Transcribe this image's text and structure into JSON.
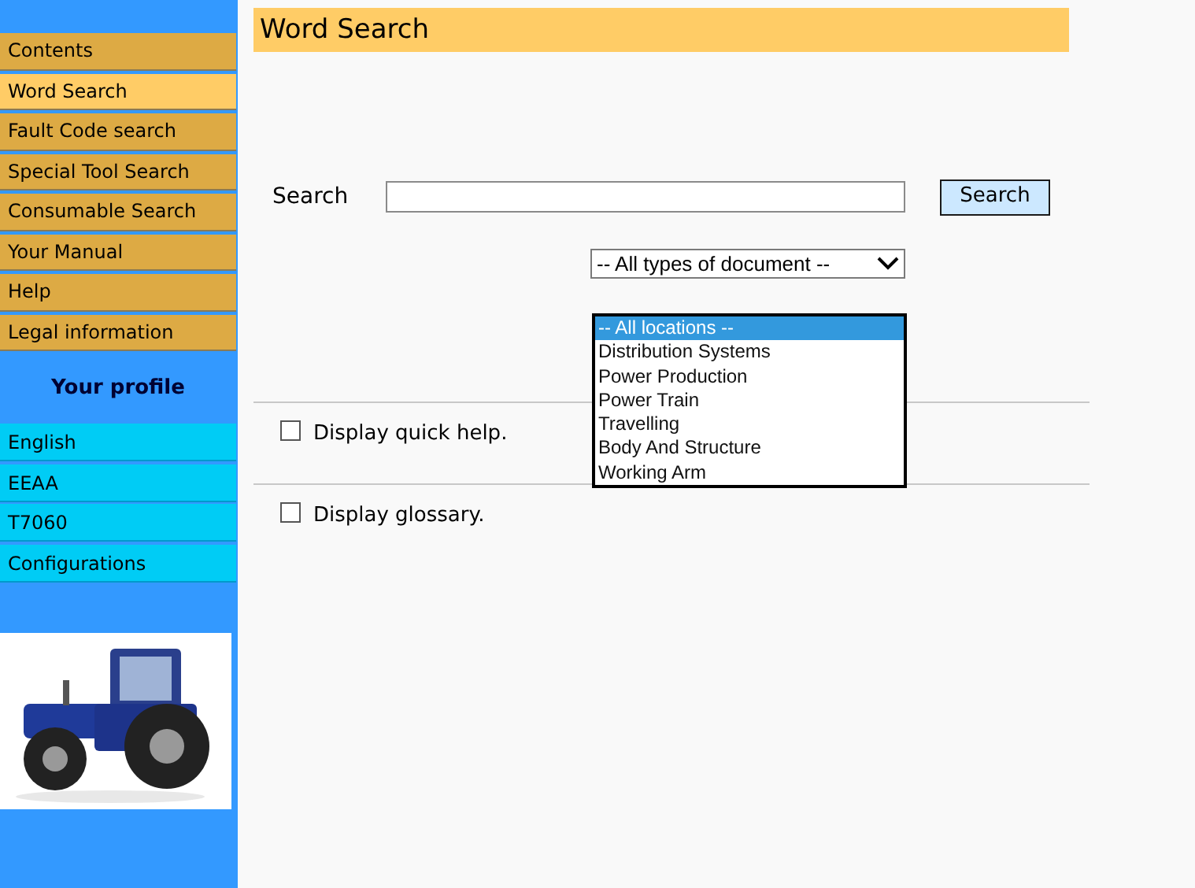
{
  "menu": [
    {
      "label": "Contents",
      "selected": false
    },
    {
      "label": "Word Search",
      "selected": true
    },
    {
      "label": "Fault Code search",
      "selected": false
    },
    {
      "label": "Special Tool Search",
      "selected": false
    },
    {
      "label": "Consumable Search",
      "selected": false
    },
    {
      "label": "Your Manual",
      "selected": false
    },
    {
      "label": "Help",
      "selected": false
    },
    {
      "label": "Legal information",
      "selected": false
    }
  ],
  "profile": {
    "title": "Your profile",
    "items": [
      "English",
      "EEAA",
      "T7060",
      "Configurations"
    ]
  },
  "page_title": "Word Search",
  "search": {
    "label": "Search",
    "button": "Search"
  },
  "document_type": {
    "value": "-- All types of document --"
  },
  "locations": [
    {
      "label": "-- All locations --",
      "selected": true
    },
    {
      "label": "Distribution Systems",
      "selected": false
    },
    {
      "label": "Power Production",
      "selected": false
    },
    {
      "label": "Power Train",
      "selected": false
    },
    {
      "label": "Travelling",
      "selected": false
    },
    {
      "label": "Body And Structure",
      "selected": false
    },
    {
      "label": "Working Arm",
      "selected": false
    }
  ],
  "options": [
    {
      "label": "Display quick help.",
      "checked": false
    },
    {
      "label": "Display glossary.",
      "checked": false
    }
  ]
}
